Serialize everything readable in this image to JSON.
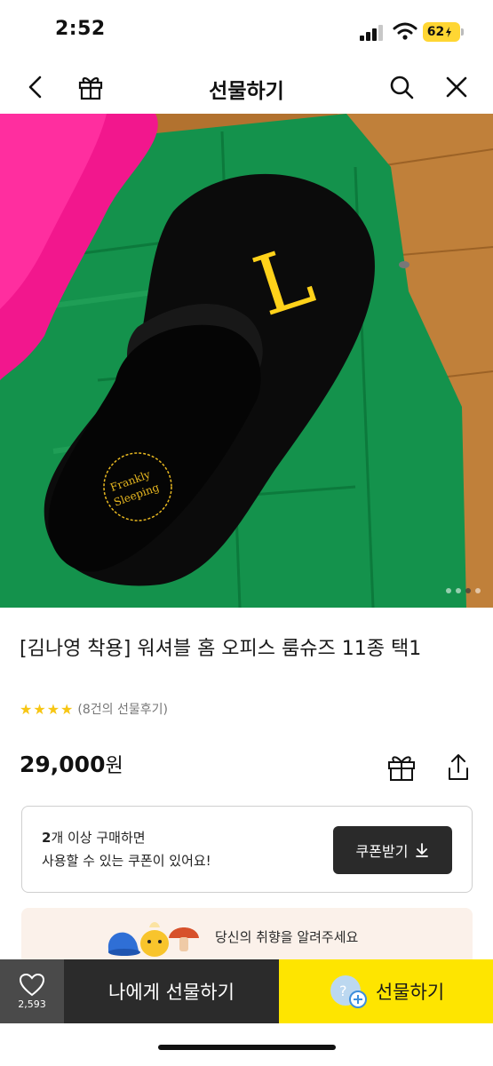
{
  "status": {
    "time": "2:52",
    "battery": "62"
  },
  "nav": {
    "title": "선물하기",
    "back_icon": "chevron-left-icon",
    "gift_icon": "gift-icon",
    "search_icon": "search-icon",
    "close_icon": "close-icon"
  },
  "product": {
    "title": "[김나영 착용] 워셔블 홈 오피스 룸슈즈 11종 택1",
    "rating_stars": "★★★★",
    "review_text": "(8건의 선물후기)",
    "price_number": "29,000",
    "price_unit": "원",
    "image_slides_total": 4,
    "image_slide_active": 3,
    "image_text": {
      "letter": "L",
      "logo_line1": "Frankly",
      "logo_line2": "Sleeping"
    }
  },
  "coupon": {
    "line1_bold": "2",
    "line1_rest": "개 이상 구매하면",
    "line2": "사용할 수 있는 쿠폰이 있어요!",
    "button_label": "쿠폰받기"
  },
  "banner": {
    "text": "당신의 취향을 알려주세요"
  },
  "bottom_bar": {
    "like_count": "2,593",
    "gift_self_label": "나에게 선물하기",
    "gift_label": "선물하기"
  },
  "colors": {
    "accent": "#fee500",
    "dark_button": "#2b2b2b",
    "star": "#f7c614",
    "price_text": "#111111"
  }
}
